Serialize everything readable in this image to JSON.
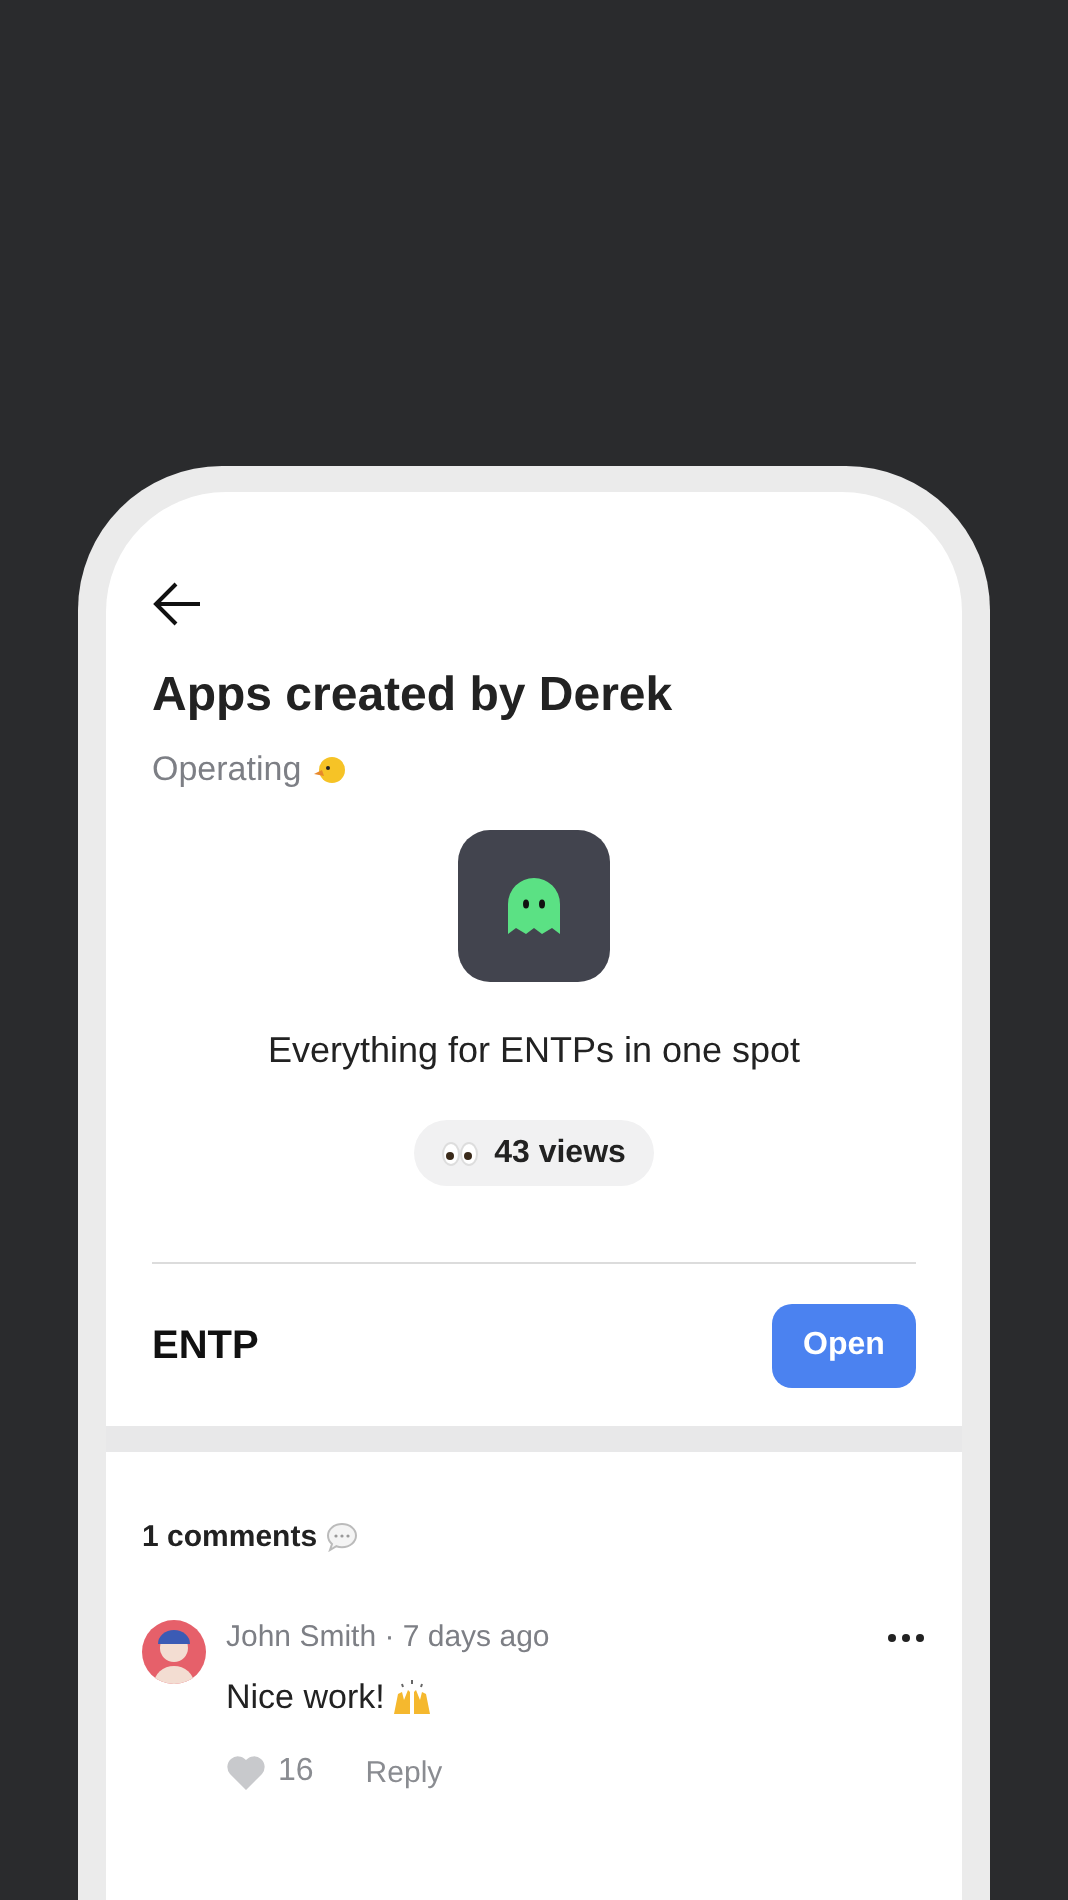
{
  "header": {
    "title": "Apps created by Derek",
    "subtitle": "Operating"
  },
  "app": {
    "description": "Everything for ENTPs in one spot",
    "views": "43 views",
    "name": "ENTP",
    "action": "Open"
  },
  "comments": {
    "heading": "1 comments",
    "items": [
      {
        "meta": "John Smith · 7 days ago",
        "text": "Nice work!",
        "likes": "16",
        "reply": "Reply"
      }
    ]
  }
}
